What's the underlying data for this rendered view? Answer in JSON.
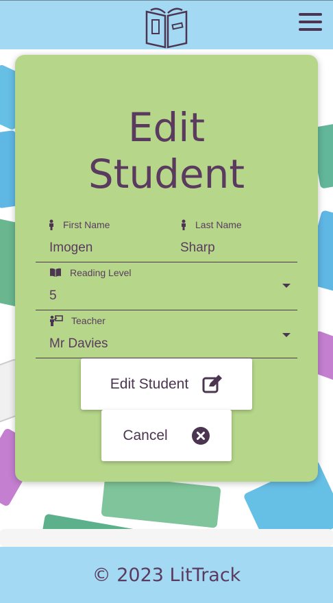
{
  "header": {
    "logo_icon": "open-book-icon",
    "menu_icon": "hamburger-menu-icon"
  },
  "form": {
    "title_line1": "Edit",
    "title_line2": "Student",
    "first_name": {
      "label": "First Name",
      "value": "Imogen",
      "icon": "person-icon"
    },
    "last_name": {
      "label": "Last Name",
      "value": "Sharp",
      "icon": "person-icon"
    },
    "reading_level": {
      "label": "Reading Level",
      "value": "5",
      "icon": "book-icon"
    },
    "teacher": {
      "label": "Teacher",
      "value": "Mr Davies",
      "icon": "teacher-icon"
    },
    "submit_label": "Edit Student",
    "submit_icon": "edit-icon",
    "cancel_label": "Cancel",
    "cancel_icon": "close-circle-icon"
  },
  "footer": {
    "text": "© 2023 LitTrack"
  },
  "colors": {
    "header_bg": "#a3d9f2",
    "card_bg": "#b6d78a",
    "text": "#5a3b5f"
  }
}
